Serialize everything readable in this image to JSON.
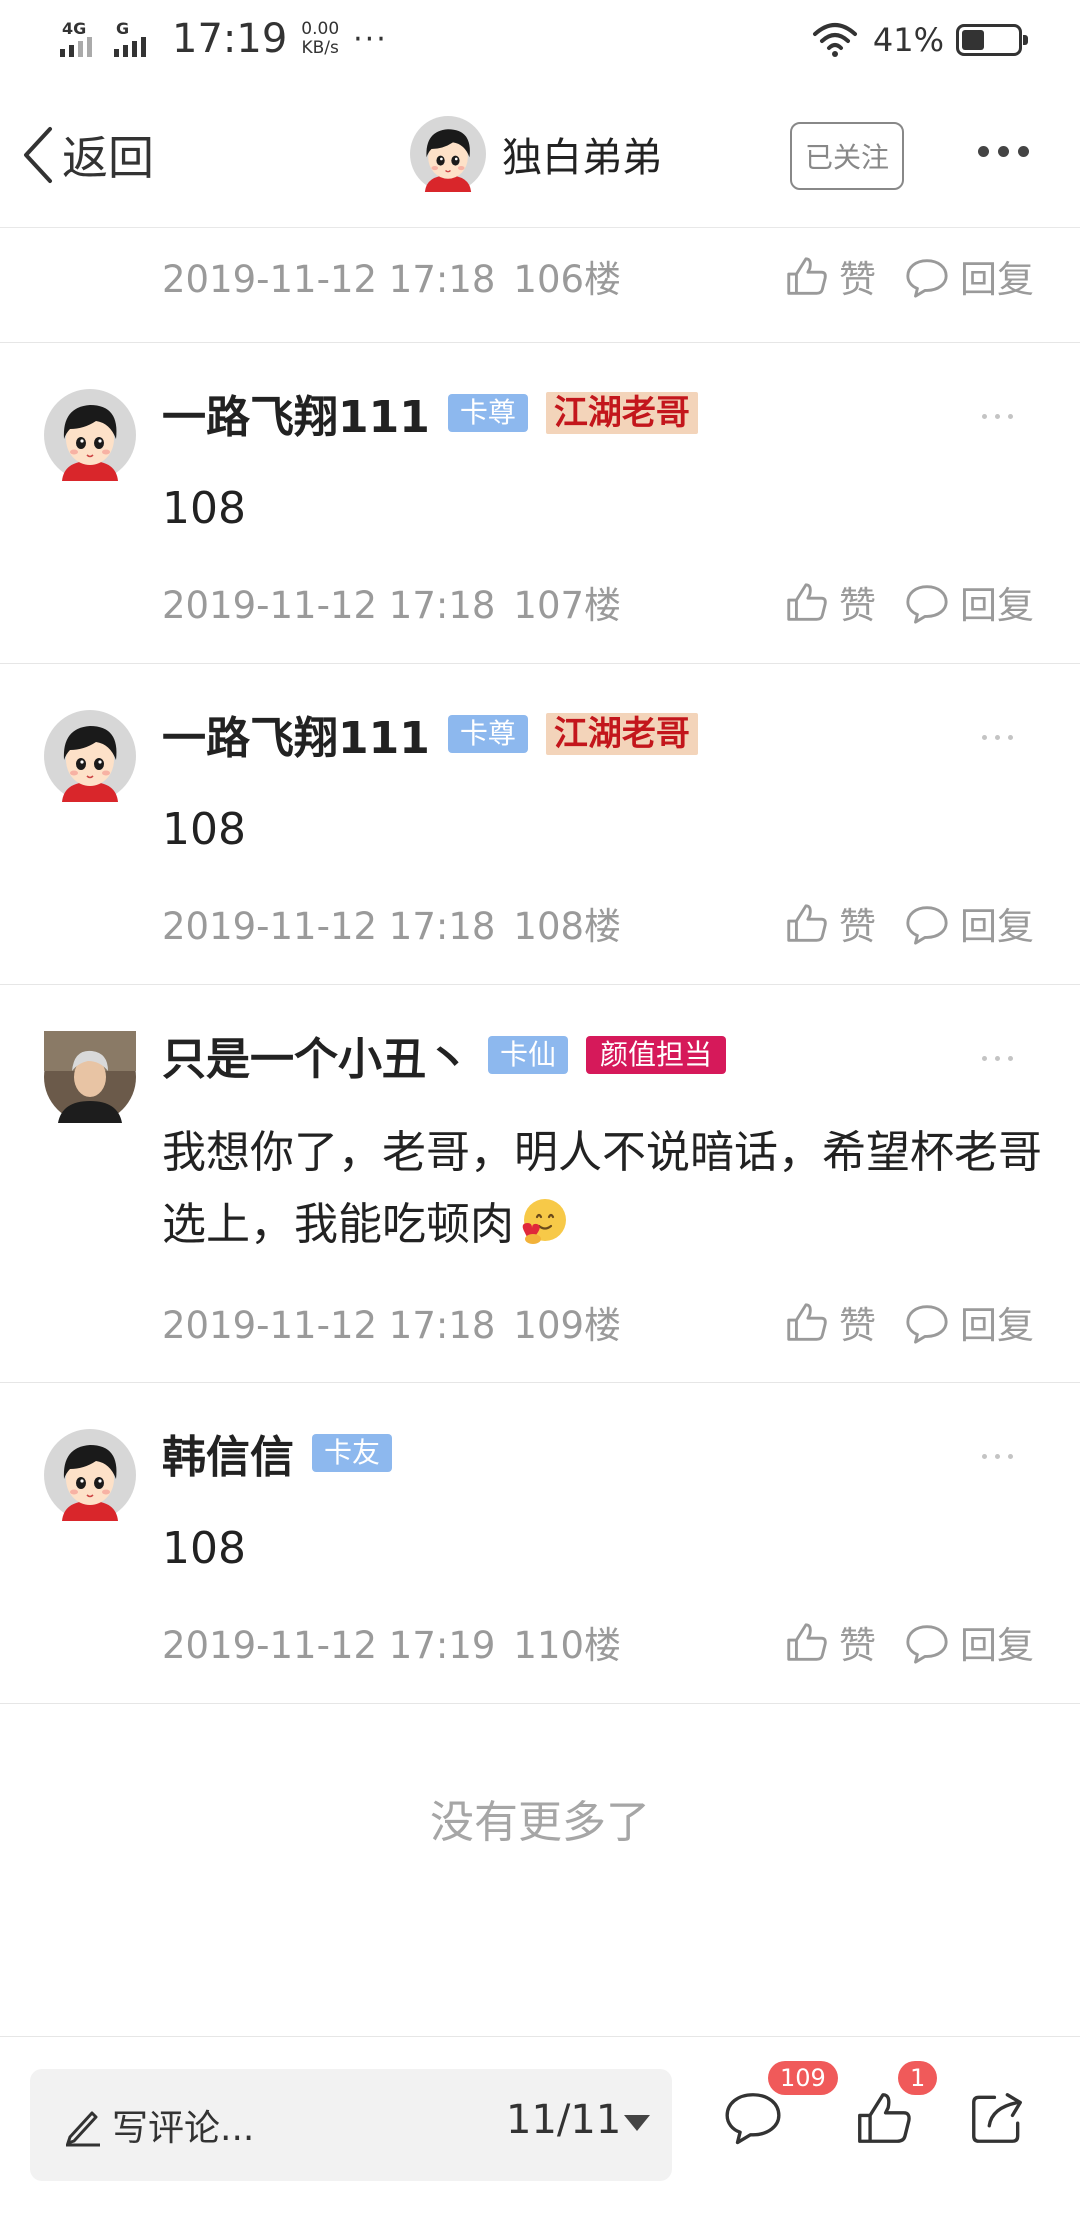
{
  "status_bar": {
    "network_1": "4G",
    "network_2": "G",
    "time": "17:19",
    "speed_value": "0.00",
    "speed_unit": "KB/s",
    "dots": "···",
    "battery_text": "41%",
    "battery_level": 0.41
  },
  "header": {
    "back_label": "返回",
    "user_name": "独白弟弟",
    "follow_label": "已关注"
  },
  "actions": {
    "like_label": "赞",
    "reply_label": "回复"
  },
  "posts": [
    {
      "time": "2019-11-12 17:18",
      "floor": "106楼"
    },
    {
      "name": "一路飞翔111",
      "badge": "卡尊",
      "badge2": "江湖老哥",
      "content": "108",
      "time": "2019-11-12 17:18",
      "floor": "107楼"
    },
    {
      "name": "一路飞翔111",
      "badge": "卡尊",
      "badge2": "江湖老哥",
      "content": "108",
      "time": "2019-11-12 17:18",
      "floor": "108楼"
    },
    {
      "name": "只是一个小丑丶",
      "badge": "卡仙",
      "badge2": "颜值担当",
      "content": "我想你了，老哥，明人不说暗话，希望杯老哥选上，我能吃顿肉",
      "time": "2019-11-12 17:18",
      "floor": "109楼"
    },
    {
      "name": "韩信信",
      "badge": "卡友",
      "content": "108",
      "time": "2019-11-12 17:19",
      "floor": "110楼"
    }
  ],
  "footer_text": "没有更多了",
  "bottom_bar": {
    "placeholder": "写评论...",
    "page_indicator": "11/11",
    "comment_count": "109",
    "like_count": "1"
  },
  "icons": [
    "signal-icon",
    "battery-icon",
    "wifi-icon",
    "back-chevron-icon",
    "more-icon",
    "thumbs-up-icon",
    "speech-bubble-icon",
    "pen-icon",
    "dropdown-caret-icon",
    "share-icon",
    "hug-emoji-icon"
  ],
  "colors": {
    "badge_blue": "#8db8ee",
    "badge_pink": "#d6195a",
    "jianghu_bg": "#f3d4ba",
    "jianghu_text": "#c3161c",
    "notification_red": "#f05a5a",
    "muted_text": "#9a9a9a"
  }
}
